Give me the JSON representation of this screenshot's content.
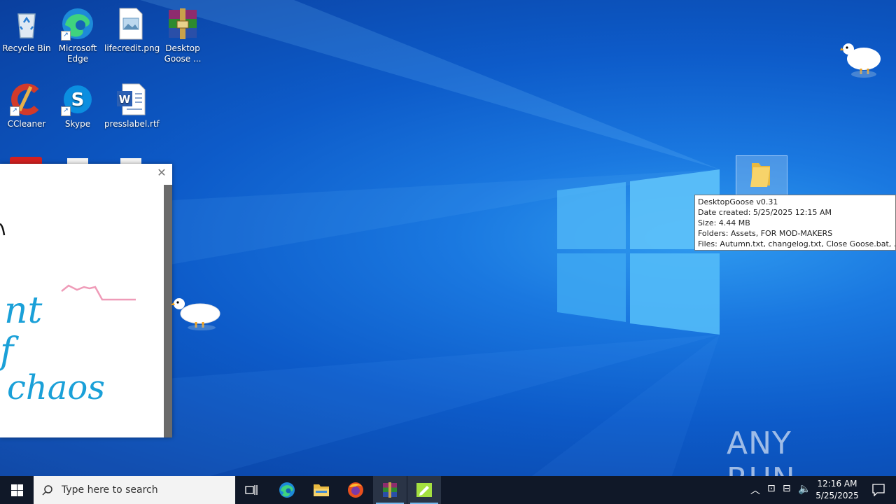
{
  "desktop_icons": [
    {
      "label": "Recycle Bin",
      "icon": "recycle-bin-icon"
    },
    {
      "label": "Microsoft Edge",
      "icon": "edge-icon"
    },
    {
      "label": "lifecredit.png",
      "icon": "image-file-icon"
    },
    {
      "label": "Desktop Goose ...",
      "icon": "winrar-archive-icon"
    },
    {
      "label": "CCleaner",
      "icon": "ccleaner-icon"
    },
    {
      "label": "Skype",
      "icon": "skype-icon"
    },
    {
      "label": "presslabel.rtf",
      "icon": "word-document-icon"
    }
  ],
  "tooltip": {
    "line1": "DesktopGoose v0.31",
    "line2": "Date created: 5/25/2025 12:15 AM",
    "line3": "Size: 4.44 MB",
    "line4": "Folders: Assets, FOR MOD-MAKERS",
    "line5": "Files: Autumn.txt, changelog.txt, Close Goose.bat, ..."
  },
  "notepad_window": {
    "handwriting_lines": [
      "nt",
      "f",
      "chaos"
    ]
  },
  "watermark": "ANY RUN",
  "taskbar": {
    "search_placeholder": "Type here to search",
    "time": "12:16 AM",
    "date": "5/25/2025",
    "apps": [
      "task-view-icon",
      "edge-icon",
      "file-explorer-icon",
      "firefox-icon",
      "winrar-icon",
      "desktop-goose-notepad-icon"
    ]
  },
  "colors": {
    "desktop_bg": "#0d5bc9",
    "taskbar_bg": "#101828",
    "accent": "#76b9ed"
  }
}
